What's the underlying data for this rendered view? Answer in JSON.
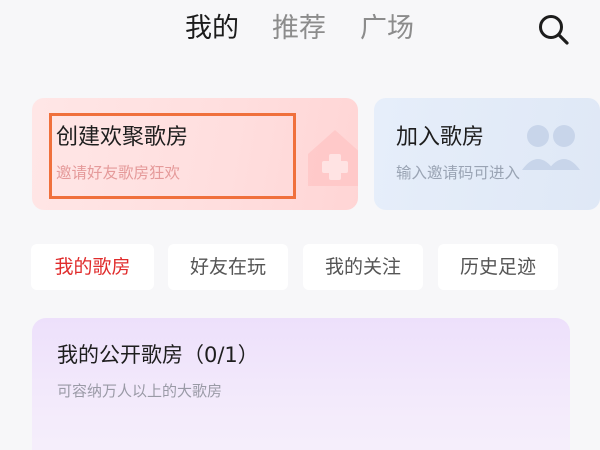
{
  "top_tabs": [
    {
      "label": "我的",
      "active": true
    },
    {
      "label": "推荐",
      "active": false
    },
    {
      "label": "广场",
      "active": false
    }
  ],
  "search": {
    "icon": "search-icon"
  },
  "create_card": {
    "title": "创建欢聚歌房",
    "subtitle": "邀请好友歌房狂欢",
    "icon": "house-plus-icon",
    "highlighted": true,
    "highlight_color": "#f0703c"
  },
  "join_card": {
    "title": "加入歌房",
    "subtitle": "输入邀请码可进入",
    "icon": "join-people-icon"
  },
  "filter_chips": [
    {
      "label": "我的歌房",
      "active": true
    },
    {
      "label": "好友在玩",
      "active": false
    },
    {
      "label": "我的关注",
      "active": false
    },
    {
      "label": "历史足迹",
      "active": false
    }
  ],
  "public_rooms": {
    "title": "我的公开歌房（0/1）",
    "subtitle": "可容纳万人以上的大歌房"
  },
  "colors": {
    "active_chip_text": "#e02c2c",
    "active_tab_text": "#1c1c1c",
    "inactive_tab_text": "#8c8c8c"
  }
}
